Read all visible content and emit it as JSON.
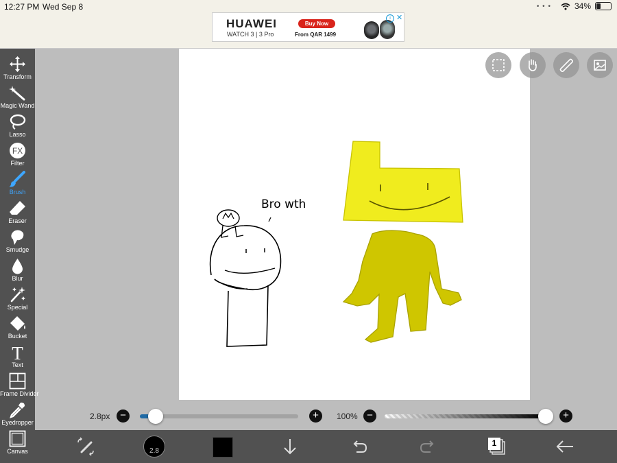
{
  "status": {
    "time": "12:27 PM",
    "date": "Wed Sep 8",
    "battery": "34%"
  },
  "ad": {
    "brand": "HUAWEI",
    "model": "WATCH 3 | 3 Pro",
    "cta": "Buy Now",
    "price": "From QAR 1499",
    "info": "i",
    "close": "✕"
  },
  "tools": [
    {
      "label": "Transform",
      "icon": "transform-icon"
    },
    {
      "label": "Magic Wand",
      "icon": "magic-wand-icon"
    },
    {
      "label": "Lasso",
      "icon": "lasso-icon"
    },
    {
      "label": "Filter",
      "icon": "fx-filter-icon",
      "glyph": "FX"
    },
    {
      "label": "Brush",
      "icon": "brush-icon",
      "active": true
    },
    {
      "label": "Eraser",
      "icon": "eraser-icon"
    },
    {
      "label": "Smudge",
      "icon": "smudge-icon"
    },
    {
      "label": "Blur",
      "icon": "blur-icon"
    },
    {
      "label": "Special",
      "icon": "special-icon"
    },
    {
      "label": "Bucket",
      "icon": "bucket-icon"
    },
    {
      "label": "Text",
      "icon": "text-icon",
      "glyph": "T"
    },
    {
      "label": "Frame Divider",
      "icon": "frame-divider-icon"
    },
    {
      "label": "Eyedropper",
      "icon": "eyedropper-icon"
    },
    {
      "label": "Canvas",
      "icon": "canvas-icon"
    }
  ],
  "canvas": {
    "handwriting": "Bro wth"
  },
  "brush_size": {
    "label": "2.8px",
    "minus": "−",
    "plus": "+",
    "value_fraction": 0.1
  },
  "opacity": {
    "label": "100%",
    "minus": "−",
    "plus": "+",
    "value_fraction": 1.0
  },
  "bottom": {
    "brush_size_badge": "2.8",
    "layer_count": "1",
    "color": "#000000"
  },
  "colors": {
    "accent": "#3ea6ff",
    "slider_fill": "#1f6aa5",
    "yellow_head": "#f0ec1e",
    "body_olive": "#cfc600"
  }
}
